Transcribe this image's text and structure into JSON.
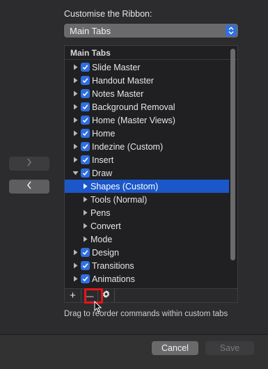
{
  "section_label": "Customise the Ribbon:",
  "dropdown": {
    "selected": "Main Tabs"
  },
  "tree": {
    "header": "Main Tabs",
    "rows": [
      {
        "label": "Slide Master",
        "checkbox": true,
        "expanded": false,
        "selected": false,
        "level": 0
      },
      {
        "label": "Handout Master",
        "checkbox": true,
        "expanded": false,
        "selected": false,
        "level": 0
      },
      {
        "label": "Notes Master",
        "checkbox": true,
        "expanded": false,
        "selected": false,
        "level": 0
      },
      {
        "label": "Background Removal",
        "checkbox": true,
        "expanded": false,
        "selected": false,
        "level": 0
      },
      {
        "label": "Home (Master Views)",
        "checkbox": true,
        "expanded": false,
        "selected": false,
        "level": 0
      },
      {
        "label": "Home",
        "checkbox": true,
        "expanded": false,
        "selected": false,
        "level": 0
      },
      {
        "label": "Indezine (Custom)",
        "checkbox": true,
        "expanded": false,
        "selected": false,
        "level": 0
      },
      {
        "label": "Insert",
        "checkbox": true,
        "expanded": false,
        "selected": false,
        "level": 0
      },
      {
        "label": "Draw",
        "checkbox": true,
        "expanded": true,
        "selected": false,
        "level": 0
      },
      {
        "label": "Shapes (Custom)",
        "checkbox": false,
        "expanded": false,
        "selected": true,
        "level": 1
      },
      {
        "label": "Tools (Normal)",
        "checkbox": false,
        "expanded": false,
        "selected": false,
        "level": 1
      },
      {
        "label": "Pens",
        "checkbox": false,
        "expanded": false,
        "selected": false,
        "level": 1
      },
      {
        "label": "Convert",
        "checkbox": false,
        "expanded": false,
        "selected": false,
        "level": 1
      },
      {
        "label": "Mode",
        "checkbox": false,
        "expanded": false,
        "selected": false,
        "level": 1
      },
      {
        "label": "Design",
        "checkbox": true,
        "expanded": false,
        "selected": false,
        "level": 0
      },
      {
        "label": "Transitions",
        "checkbox": true,
        "expanded": false,
        "selected": false,
        "level": 0
      },
      {
        "label": "Animations",
        "checkbox": true,
        "expanded": false,
        "selected": false,
        "level": 0
      }
    ]
  },
  "toolbar": {
    "add_label": "+",
    "remove_label": "—",
    "settings_icon": "gear-icon"
  },
  "hint": "Drag to reorder commands within custom tabs",
  "buttons": {
    "cancel": "Cancel",
    "save": "Save"
  },
  "colors": {
    "accent": "#2f6fe0",
    "selection": "#1b57c9",
    "highlight": "#e8141c"
  }
}
